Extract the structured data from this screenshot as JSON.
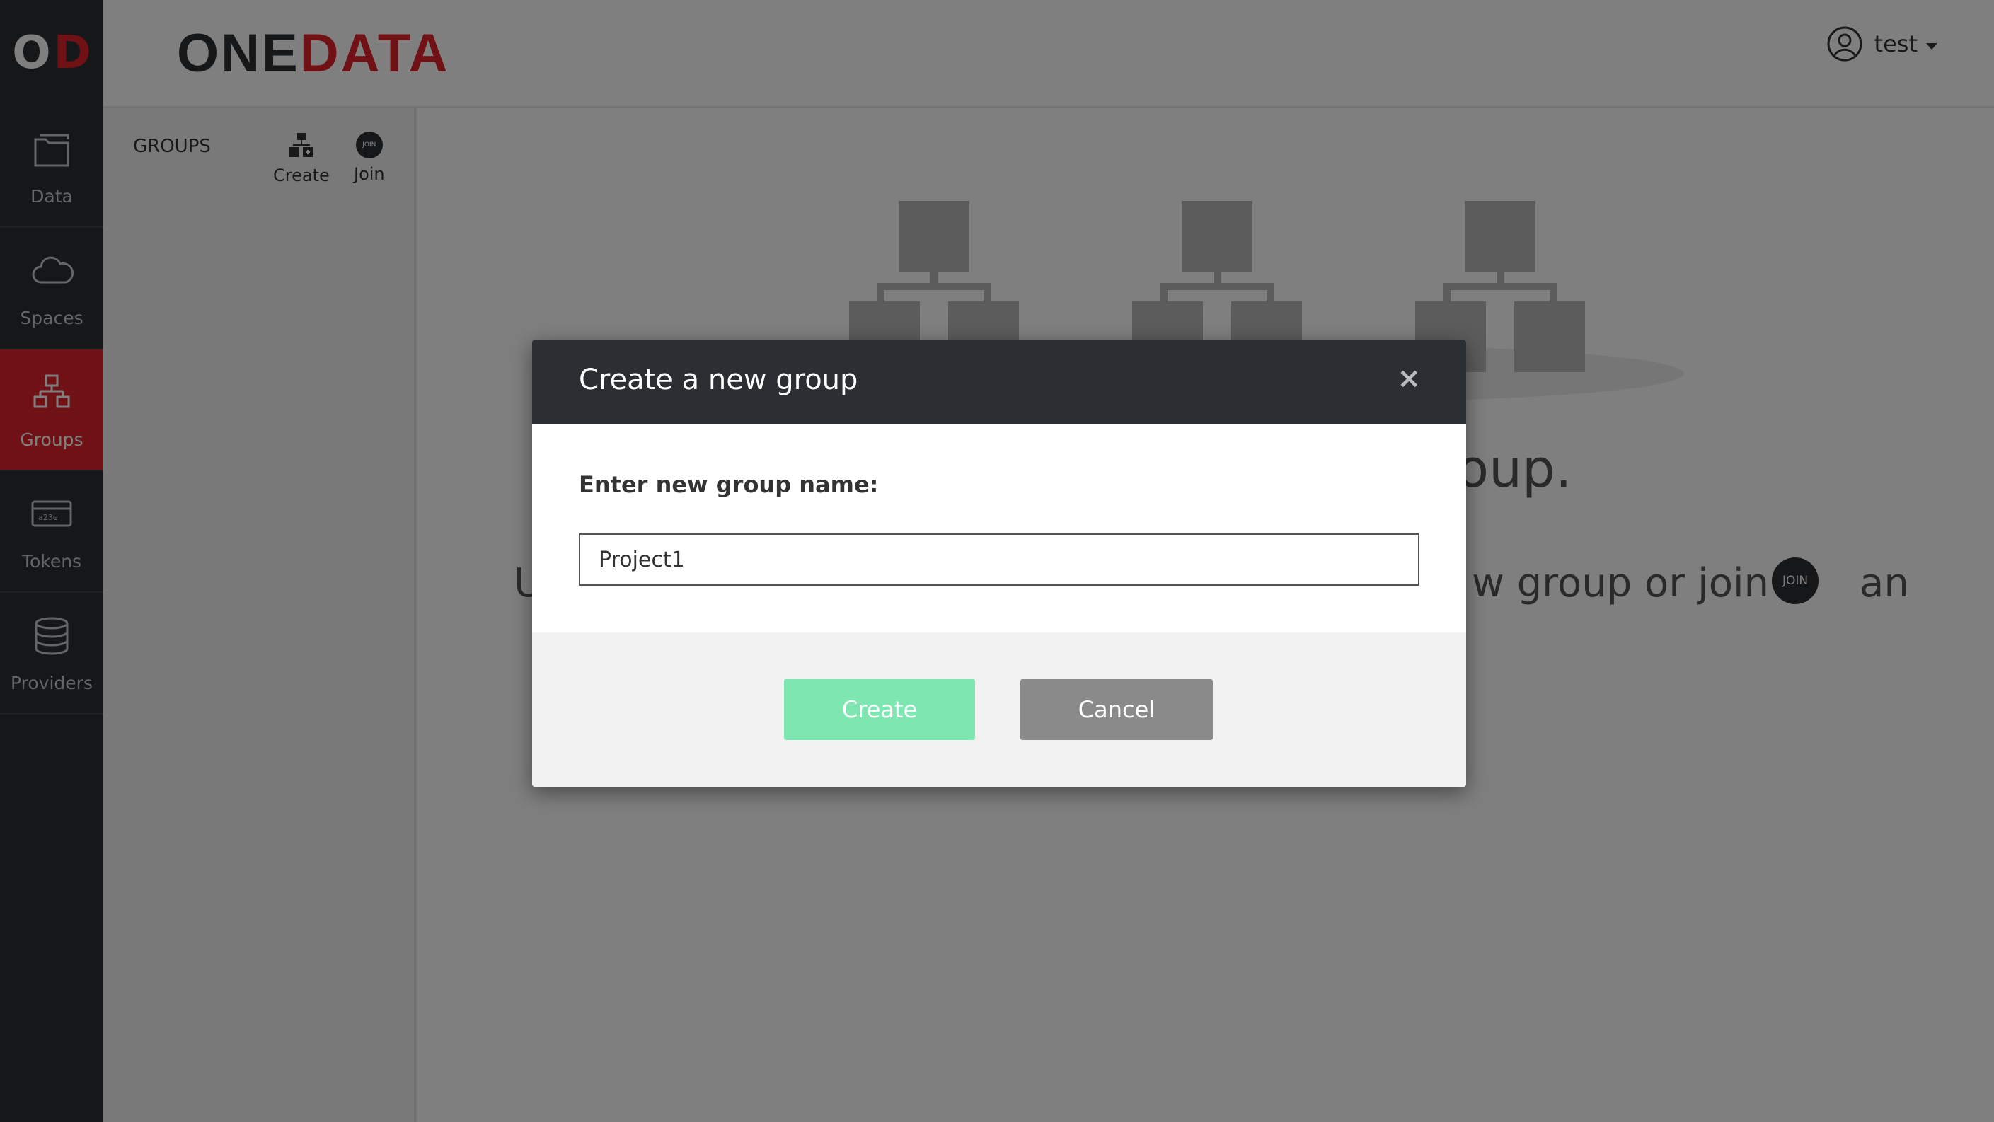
{
  "logo": {
    "left": "O",
    "right": "D"
  },
  "nav": {
    "items": [
      {
        "label": "Data",
        "icon": "folder-icon"
      },
      {
        "label": "Spaces",
        "icon": "cloud-icon"
      },
      {
        "label": "Groups",
        "icon": "groups-icon",
        "active": true
      },
      {
        "label": "Tokens",
        "icon": "token-icon",
        "icon_text": "a23e"
      },
      {
        "label": "Providers",
        "icon": "database-icon"
      }
    ]
  },
  "header": {
    "brand_one": "ONE",
    "brand_data": "DATA",
    "user": "test"
  },
  "subnav": {
    "title": "GROUPS",
    "create_label": "Create",
    "join_label": "Join",
    "join_badge": "JOIN"
  },
  "main": {
    "headline_fragment": "roup.",
    "sub_left": "U",
    "sub_right": "w group or join",
    "join_badge": "JOIN",
    "sub_end": "an"
  },
  "modal": {
    "title": "Create a new group",
    "close": "×",
    "field_label": "Enter new group name:",
    "field_value": "Project1",
    "create_label": "Create",
    "cancel_label": "Cancel"
  },
  "colors": {
    "nav_bg": "#2b2e33",
    "accent_red": "#e1222b",
    "create_green": "#7ee6b0",
    "cancel_gray": "#8a8a8a"
  }
}
